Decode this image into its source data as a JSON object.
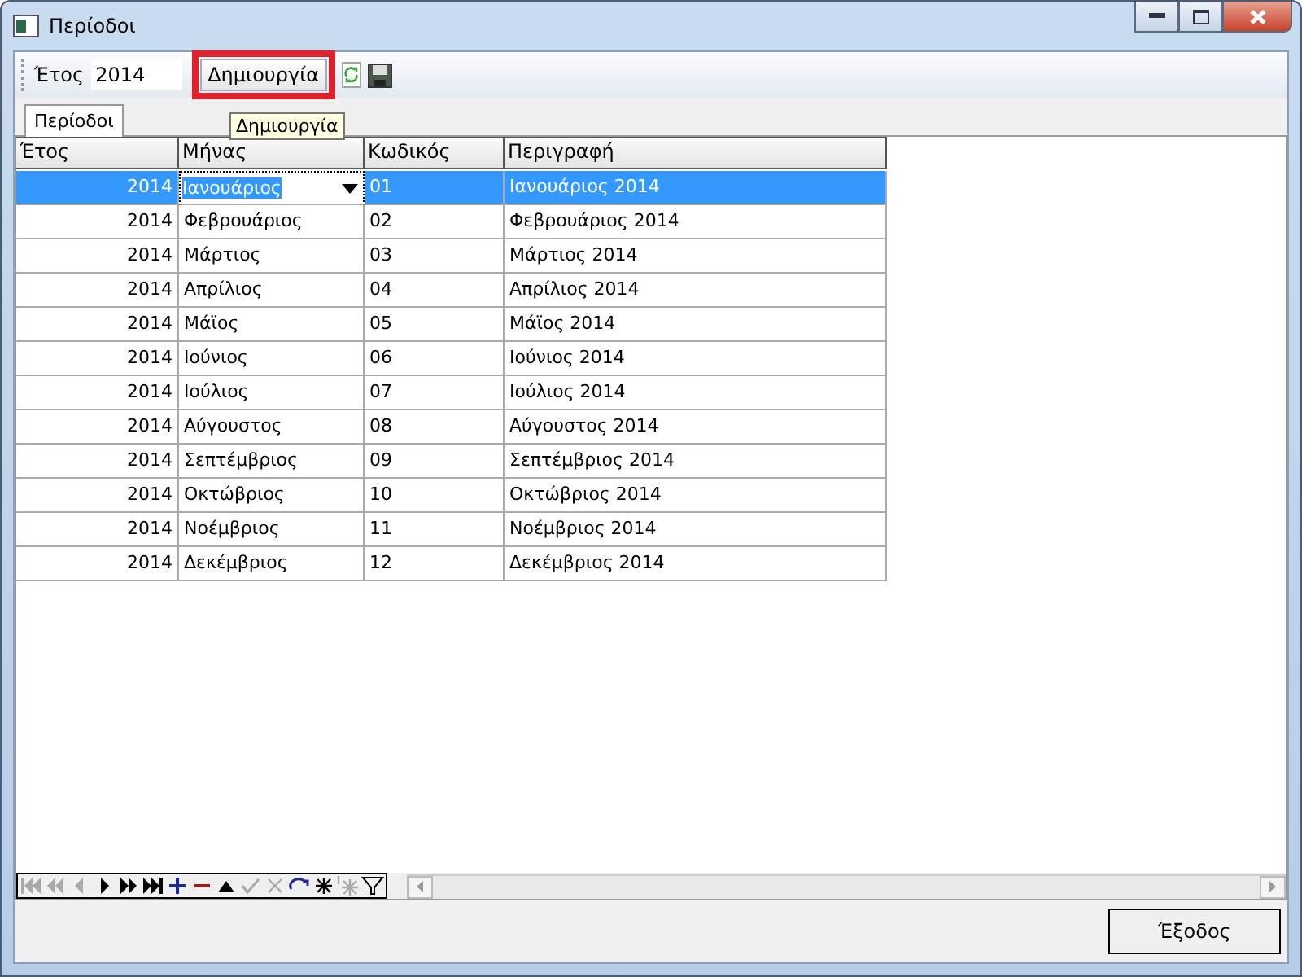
{
  "window": {
    "title": "Περίοδοι"
  },
  "toolbar": {
    "year_label": "Έτος",
    "year_value": "2014",
    "create_button": "Δημιουργία",
    "tooltip": "Δημιουργία"
  },
  "tabs": [
    {
      "label": "Περίοδοι",
      "selected": true
    }
  ],
  "table": {
    "columns": [
      "Έτος",
      "Μήνας",
      "Κωδικός",
      "Περιγραφή"
    ],
    "rows": [
      {
        "year": "2014",
        "month": "Ιανουάριος",
        "code": "01",
        "description": "Ιανουάριος 2014",
        "selected": true
      },
      {
        "year": "2014",
        "month": "Φεβρουάριος",
        "code": "02",
        "description": "Φεβρουάριος 2014",
        "selected": false
      },
      {
        "year": "2014",
        "month": "Μάρτιος",
        "code": "03",
        "description": "Μάρτιος 2014",
        "selected": false
      },
      {
        "year": "2014",
        "month": "Απρίλιος",
        "code": "04",
        "description": "Απρίλιος 2014",
        "selected": false
      },
      {
        "year": "2014",
        "month": "Μάϊος",
        "code": "05",
        "description": "Μάϊος 2014",
        "selected": false
      },
      {
        "year": "2014",
        "month": "Ιούνιος",
        "code": "06",
        "description": "Ιούνιος 2014",
        "selected": false
      },
      {
        "year": "2014",
        "month": "Ιούλιος",
        "code": "07",
        "description": "Ιούλιος 2014",
        "selected": false
      },
      {
        "year": "2014",
        "month": "Αύγουστος",
        "code": "08",
        "description": "Αύγουστος 2014",
        "selected": false
      },
      {
        "year": "2014",
        "month": "Σεπτέμβριος",
        "code": "09",
        "description": "Σεπτέμβριος 2014",
        "selected": false
      },
      {
        "year": "2014",
        "month": "Οκτώβριος",
        "code": "10",
        "description": "Οκτώβριος 2014",
        "selected": false
      },
      {
        "year": "2014",
        "month": "Νοέμβριος",
        "code": "11",
        "description": "Νοέμβριος 2014",
        "selected": false
      },
      {
        "year": "2014",
        "month": "Δεκέμβριος",
        "code": "12",
        "description": "Δεκέμβριος 2014",
        "selected": false
      }
    ]
  },
  "navigator": [
    {
      "kind": "first",
      "disabled": true
    },
    {
      "kind": "prev_page",
      "disabled": true
    },
    {
      "kind": "prev",
      "disabled": true
    },
    {
      "kind": "next",
      "disabled": false
    },
    {
      "kind": "next_page",
      "disabled": false
    },
    {
      "kind": "last",
      "disabled": false
    },
    {
      "kind": "append",
      "disabled": false
    },
    {
      "kind": "delete",
      "disabled": false
    },
    {
      "kind": "edit",
      "disabled": false
    },
    {
      "kind": "post",
      "disabled": true
    },
    {
      "kind": "cancel",
      "disabled": true
    },
    {
      "kind": "refresh",
      "disabled": false
    },
    {
      "kind": "bookmark",
      "disabled": false
    },
    {
      "kind": "goto_bookmark",
      "disabled": true
    },
    {
      "kind": "filter",
      "disabled": false
    }
  ],
  "footer": {
    "exit_button": "Έξοδος"
  }
}
